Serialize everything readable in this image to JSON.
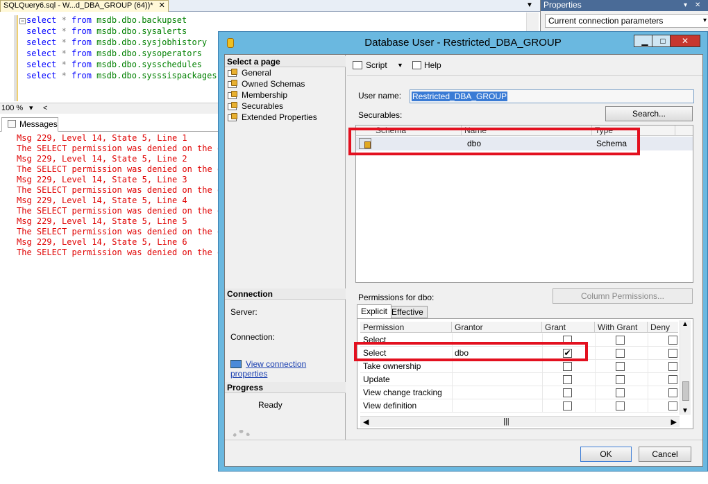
{
  "doc_tab": {
    "title": "SQLQuery6.sql - W...d_DBA_GROUP (64))*",
    "close": "✕"
  },
  "query_lines": [
    {
      "kw1": "select",
      "op": " * ",
      "kw2": "from",
      "obj": " msdb.dbo.backupset"
    },
    {
      "kw1": "select",
      "op": " * ",
      "kw2": "from",
      "obj": " msdb.dbo.sysalerts"
    },
    {
      "kw1": "select",
      "op": " * ",
      "kw2": "from",
      "obj": " msdb.dbo.sysjobhistory"
    },
    {
      "kw1": "select",
      "op": " * ",
      "kw2": "from",
      "obj": " msdb.dbo.sysoperators"
    },
    {
      "kw1": "select",
      "op": " * ",
      "kw2": "from",
      "obj": " msdb.dbo.sysschedules"
    },
    {
      "kw1": "select",
      "op": " * ",
      "kw2": "from",
      "obj": " msdb.dbo.sysssispackages"
    }
  ],
  "zoom": {
    "value": "100 %",
    "dropdown": "▾",
    "scroll_left": "<"
  },
  "messages_tab": {
    "label": "Messages"
  },
  "messages": [
    "Msg 229, Level 14, State 5, Line 1",
    "The SELECT permission was denied on the ob",
    "Msg 229, Level 14, State 5, Line 2",
    "The SELECT permission was denied on the ob",
    "Msg 229, Level 14, State 5, Line 3",
    "The SELECT permission was denied on the ob",
    "Msg 229, Level 14, State 5, Line 4",
    "The SELECT permission was denied on the ob",
    "Msg 229, Level 14, State 5, Line 5",
    "The SELECT permission was denied on the ob",
    "Msg 229, Level 14, State 5, Line 6",
    "The SELECT permission was denied on the ob"
  ],
  "properties": {
    "title": "Properties",
    "dropdown_value": "Current connection parameters"
  },
  "dialog": {
    "title": "Database User - Restricted_DBA_GROUP",
    "select_page_header": "Select a page",
    "pages": [
      "General",
      "Owned Schemas",
      "Membership",
      "Securables",
      "Extended Properties"
    ],
    "connection_header": "Connection",
    "server_label": "Server:",
    "connection_label": "Connection:",
    "view_connection_link": "View connection properties",
    "progress_header": "Progress",
    "progress_status": "Ready",
    "toolbar": {
      "script": "Script",
      "help": "Help"
    },
    "user_name_label": "User name:",
    "user_name_value": "Restricted_DBA_GROUP",
    "securables_label": "Securables:",
    "search_button": "Search...",
    "securables_columns": [
      "Schema",
      "Name",
      "Type"
    ],
    "securables_rows": [
      {
        "schema": "",
        "name": "dbo",
        "type": "Schema"
      }
    ],
    "permissions_label": "Permissions for dbo:",
    "column_permissions_button": "Column Permissions...",
    "perm_tabs": [
      "Explicit",
      "Effective"
    ],
    "perm_columns": [
      "Permission",
      "Grantor",
      "Grant",
      "With Grant",
      "Deny"
    ],
    "perm_rows": [
      {
        "permission": "Select",
        "grantor": "",
        "grant": false,
        "with_grant": false,
        "deny": false
      },
      {
        "permission": "Select",
        "grantor": "dbo",
        "grant": true,
        "with_grant": false,
        "deny": false
      },
      {
        "permission": "Take ownership",
        "grantor": "",
        "grant": false,
        "with_grant": false,
        "deny": false
      },
      {
        "permission": "Update",
        "grantor": "",
        "grant": false,
        "with_grant": false,
        "deny": false
      },
      {
        "permission": "View change tracking",
        "grantor": "",
        "grant": false,
        "with_grant": false,
        "deny": false
      },
      {
        "permission": "View definition",
        "grantor": "",
        "grant": false,
        "with_grant": false,
        "deny": false
      }
    ],
    "ok_button": "OK",
    "cancel_button": "Cancel"
  },
  "colors": {
    "error_text": "#e00000",
    "annotation": "#e3101f",
    "dialog_frame": "#6ab8e0",
    "link": "#1a3fb0"
  }
}
